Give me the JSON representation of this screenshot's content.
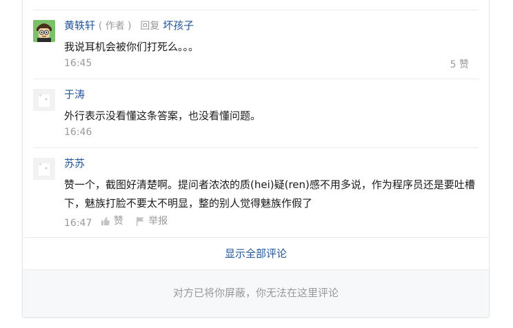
{
  "comments": [
    {
      "author": "黄轶轩",
      "author_tag": "( 作者 )",
      "reply_label": "回复",
      "reply_to": "坏孩子",
      "text": "我说耳机会被你们打死么。。。",
      "time": "16:45",
      "likes": "5 赞"
    },
    {
      "author": "于涛",
      "text": "外行表示没看懂这条答案，也没看懂问题。",
      "time": "16:46"
    },
    {
      "author": "苏苏",
      "text": "赞一个，截图好清楚啊。提问者浓浓的质(hei)疑(ren)感不用多说，作为程序员还是要吐槽下，魅族打脸不要太不明显，整的别人觉得魅族作假了",
      "time": "16:47",
      "like_label": "赞",
      "report_label": "举报"
    }
  ],
  "show_all": "显示全部评论",
  "blocked_notice": "对方已将你屏蔽，你无法在这里评论",
  "colors": {
    "link": "#225599",
    "muted": "#999999"
  },
  "icons": [
    "thumbs-up-icon",
    "flag-icon"
  ]
}
